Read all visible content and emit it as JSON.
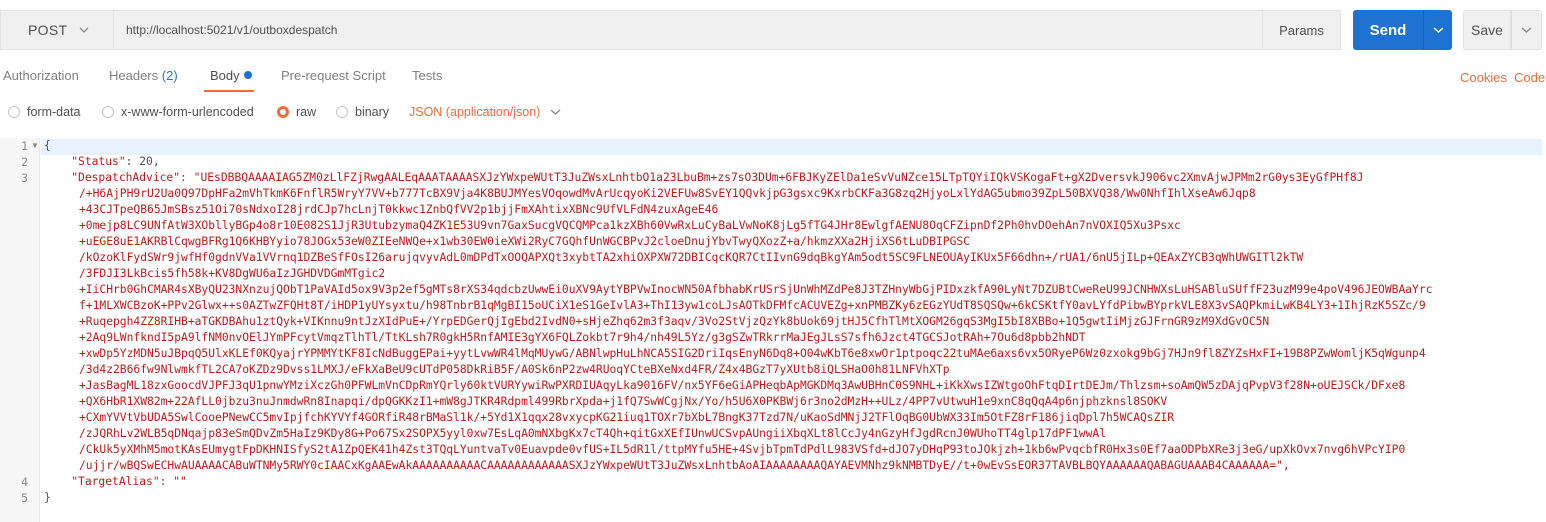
{
  "request": {
    "method": "POST",
    "url": "http://localhost:5021/v1/outboxdespatch",
    "params_label": "Params",
    "send_label": "Send",
    "save_label": "Save"
  },
  "tabs": {
    "authorization": "Authorization",
    "headers": "Headers",
    "headers_count": "(2)",
    "body": "Body",
    "prerequest": "Pre-request Script",
    "tests": "Tests",
    "cookies": "Cookies",
    "code": "Code"
  },
  "body_modes": {
    "form_data": "form-data",
    "urlencoded": "x-www-form-urlencoded",
    "raw": "raw",
    "binary": "binary",
    "content_type": "JSON (application/json)"
  },
  "editor": {
    "line_numbers": [
      "1",
      "2",
      "3",
      "4",
      "5"
    ],
    "open_brace": "{",
    "close_brace": "}",
    "status_key": "\"Status\"",
    "status_value": "20",
    "despatch_key": "\"DespatchAdvice\"",
    "target_key": "\"TargetAlias\"",
    "target_value": "\"\"",
    "despatch_lines": [
      "\"UEsDBBQAAAAIAG5ZM0zLlFZjRwgAALEqAAATAAAASXJzYWxpeWUtT3JuZWsxLnhtbO1a23LbuBm+zs7sO3DUm+6FBJKyZElDa1eSvVuNZce15LTpTQYiIQkVSKogaFt+gX2DversvkJ906vc2XmvAjwJPMm2rG0ys3EyGfPHf8J",
      "/+H6AjPH9rU2Ua0Q97DpHFa2mVhTkmK6FnflR5WryY7VV+b777TcBX9Vja4K8BUJMYesVOqowdMvArUcqyoKi2VEFUw8SvEY1QQvkjpG3gsxc9KxrbCKFa3G8zq2HjyoLxlYdAG5ubmo39ZpL50BXVQ38/Ww0NhfIhlXseAw6Jqp8",
      "+43CJTpeQB65JmSBsz51Oi70sNdxoI28jrdCJp7hcLnjT0kkwc1ZnbQfVV2p1bjjFmXAhtixXBNc9UfVLFdN4zuxAgeE46",
      "+0mejp8LC9UNfAtW3XObllyBGp4o8r10E082S1JjR3UtubzymaQ4ZK1E53U9vn7GaxSucgVQCQMPca1kzXBh60VwRxLuCyBaLVwNoK8jLg5fTG4JHr8EwlgfAENU8OqCFZipnDf2Ph0hvDOehAn7nVOXIQ5Xu3Psxc",
      "+uEGE8uE1AKRBlCqwgBFRg1Q6KHBYyio78JOGx53eW0ZIEeNWQe+x1wb30EW0ieXWi2RyC7GQhfUnWGCBPvJ2cloeDnujYbvTwyQXozZ+a/hkmzXXa2HjiXS6tLuDBIPGSC",
      "/kOzoKlFydSWr9jwfHf0gdnVVa1VVrnq1DZBeSfFOsI26arujqvyvAdL0mDPdTxOOQAPXQt3xybtTA2xhiOXPXW72DBICqcKQR7CtIIvnG9dqBkgYAm5odt5SC9FLNEOUAyIKUx5F66dhn+/rUA1/6nU5jILp+QEAxZYCB3qWhUWGITl2kTW",
      "/3FDJI3LkBcis5fh58k+KV8DgWU6aIzJGHDVDGmMTgic2",
      "+IiCHrb0GhCMAR4sXByQU23NXnzujQObT1PaVAId5ox9V3p2ef5gMTs8rXS34qdcbzUwwEi0uXV9AytYBPVwInocWN50AfbhabKrUSrSjUnWhMZdPe8J3TZHnyWbGjPIDxzkfA90LyNt7DZUBtCweReU99JCNHWXsLuHSABluSUffF23uzM99e4poV496JEOWBAaYrc",
      "f+1MLXWCBzoK+PPv2Glwx++s0AZTwZFQHt8T/iHDP1yUYsyxtu/h98TnbrB1qMgBI15oUCiX1eS1GeIvlA3+ThI13yw1coLJsAOTkDFMfcACUVEZg+xnPMBZKy6zEGzYUdT8SQSQw+6kCSKtfY0avLYfdPibwBYprkVLE8X3vSAQPkmiLwKB4LY3+1IhjRzK5SZc/9",
      "+Ruqepgh4ZZ8RIHB+aTGKDBAhu1ztQyk+VIKnnu9ntJzXIdPuE+/YrpEDGerQjIgEbd2IvdN0+sHjeZhq62m3f3aqv/3Vo2StVjzQzYk8bUok69jtHJ5CfhTlMtXOGM26gqS3MgI5bI8XBBo+1Q5gwtIiMjzGJFrnGR9zM9XdGvOC5N",
      "+2Aq9LWnfkndI5pA9lfNM0nvOElJYmPFcytVmqzTlhTl/TtKLsh7R0gkH5RnfAMIE3gYX6FQLZokbt7r9h4/nh49L5Yz/g3gSZwTRkrrMaJEgJLsS7sfh6Jzct4TGCSJotRAh+7Ou6d8pbb2hNDT",
      "+xwDp5YzMDN5uJBpqQ5UlxKLEf0KQyajrYPMMYtKF8IcNdBuggEPai+yytLvwWR4lMqMUywG/ABNlwpHuLhNCA5SIG2DriIqsEnyN6Dq8+O04wKbT6e8xwOr1ptpoqc22tuMAe6axs6vx5ORyeP6Wz0zxokg9bGj7HJn9fl8ZYZsHxFI+19B8PZwWomljK5qWgunp4",
      "/3d4z2B66fw9NlwmkfTL2CA7oKZDz9Dvss1LMXJ/eFkXaBeU9cUTdP058DkRiB5F/A0Sk6nP2zw4RUoqYCteBXeNxd4FR/Z4x4BGzT7yXUtb8iQLSHaO0h81LNFVhXTp",
      "+JasBagML18zxGoocdVJPFJ3qU1pnwYMziXczGh0PFWLmVnCDpRmYQrly60ktVURYywiRwPXRDIUAqyLka9016FV/nx5YF6eGiAPHeqbApMGKDMq3AwUBHnC0S9NHL+iKkXwsIZWtgoOhFtqDIrtDEJm/Thlzsm+soAmQW5zDAjqPvpV3f28N+oUEJSCk/DFxe8",
      "+QX6HbR1XW82m+22AfLL0jbzu3nuJnmdwRn8Inapqi/dpQGKKzI1+mW8gJTKR4Rdpml499RbrXpda+j1fQ7SwWCgjNx/Yo/h5U6X0PKBWj6r3no2dMzH++ULz/4PP7vUtwuH1e9xnC8qQqA4p6njphzknsl8SOKV",
      "+CXmYVVtVbUDA5SwlCooePNewCC5mvIpjfchKYVYf4GORfiR48rBMaSl1k/+5Yd1X1qqx28vxycpKG21iuq1TOXr7bXbL7BngK37Tzd7N/uKaoSdMNjJ2TFlOqBG0UbWX33Im5OtFZ8rF186jiqDpl7h5WCAQsZIR",
      "/zJQRhLv2WLB5qDNqajp83eSmQDvZm5HaIz9KDy8G+Po67Sx2SOPX5yyl0xw7EsLqA0mNXbgKx7cT4Qh+qitGxXEfIUnwUCSvpAUngiiXbqXLt8lCcJy4nGzyHfJgdRcnJ0WUhoTT4glp17dPF1wwAl",
      "/CkUk5yXMhM5motKAsEUmygtFpDKHNISfyS2tA1ZpQEK41h4Zst3TQqLYuntvaTv0Euavpde0vfUS+IL5dR1l/ttpMYfu5HE+4SvjbTpmTdPdlL983VSfd+dJO7yDHqP93toJOkjzh+1kb6wPvqcbfR0Hx3s0Ef7aaODPbXRe3j3eG/upXkOvx7nvg6hVPcYIP0",
      "/ujjr/wBQSwECHwAUAAAACABuWTNMy5RWY0cIAACxKgAAEwAkAAAAAAAAAACAAAAAAAAAAAASXJzYWxpeWUtT3JuZWsxLnhtbAoAIAAAAAAAAQAYAEVMNhz9kNMBTDyE//t+0wEvSsEOR37TAVBLBQYAAAAAAQABAGUAAAB4CAAAAAA=\","
    ]
  }
}
